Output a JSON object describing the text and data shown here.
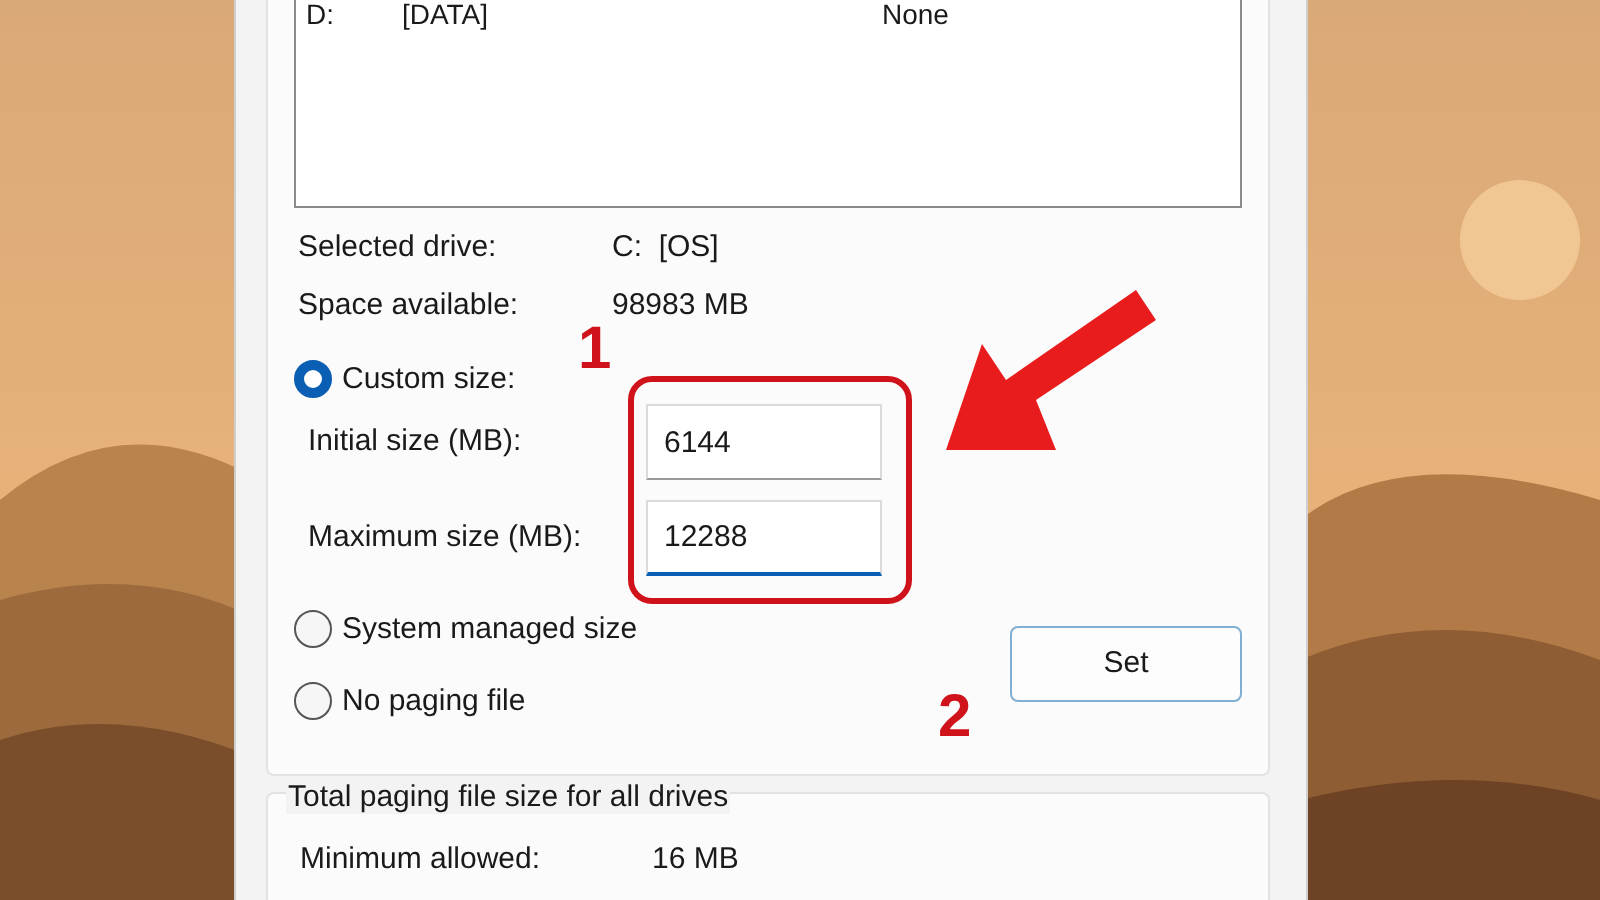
{
  "drive_list": {
    "rows": [
      {
        "drive": "D:",
        "label": "[DATA]",
        "paging_size": "None"
      }
    ]
  },
  "selected_drive": {
    "label": "Selected drive:",
    "value": "C:  [OS]"
  },
  "space_available": {
    "label": "Space available:",
    "value": "98983 MB"
  },
  "options": [
    {
      "label": "Custom size:",
      "selected": true
    },
    {
      "label": "System managed size",
      "selected": false
    },
    {
      "label": "No paging file",
      "selected": false
    }
  ],
  "fields": [
    {
      "label": "Initial size (MB):",
      "value": "6144",
      "focused": false
    },
    {
      "label": "Maximum size (MB):",
      "value": "12288",
      "focused": true
    }
  ],
  "set_button": "Set",
  "total_group": {
    "title": "Total paging file size for all drives",
    "rows": [
      {
        "label": "Minimum allowed:",
        "value": "16 MB"
      }
    ]
  },
  "annotations": [
    {
      "label": "1"
    },
    {
      "label": "2"
    }
  ]
}
